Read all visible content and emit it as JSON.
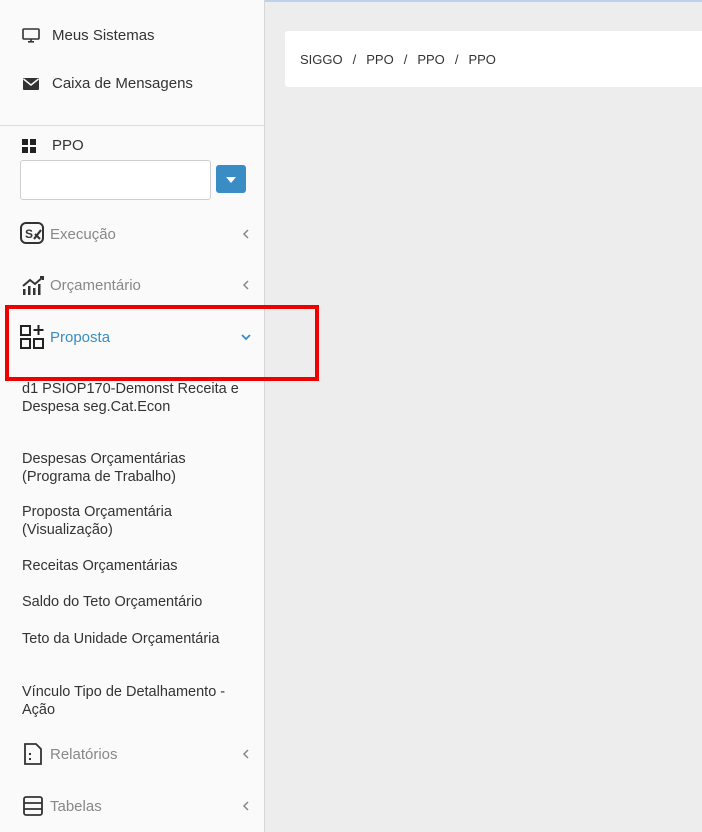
{
  "sidebar": {
    "top_links": [
      {
        "label": "Meus Sistemas",
        "icon": "monitor-icon"
      },
      {
        "label": "Caixa de Mensagens",
        "icon": "envelope-icon"
      }
    ],
    "module": {
      "label": "PPO",
      "icon": "grid-icon",
      "input_value": "",
      "dropdown_icon": "caret-down-icon"
    },
    "menu": [
      {
        "label": "Execução",
        "icon": "execution-icon",
        "expanded": false
      },
      {
        "label": "Orçamentário",
        "icon": "chart-icon",
        "expanded": false
      },
      {
        "label": "Proposta",
        "icon": "add-grid-icon",
        "expanded": true
      },
      {
        "label": "Relatórios",
        "icon": "report-icon",
        "expanded": false
      },
      {
        "label": "Tabelas",
        "icon": "table-icon",
        "expanded": false
      }
    ],
    "proposta_items": [
      "d1 PSIOP170-Demonst Receita e Despesa seg.Cat.Econ",
      "Despesas Orçamentárias (Programa de Trabalho)",
      "Proposta Orçamentária (Visualização)",
      "Receitas Orçamentárias",
      "Saldo do Teto Orçamentário",
      "Teto da Unidade Orçamentária",
      "Vínculo Tipo de Detalhamento - Ação"
    ]
  },
  "breadcrumb": [
    "SIGGO",
    "PPO",
    "PPO",
    "PPO"
  ],
  "colors": {
    "accent": "#3a8cc4",
    "highlight": "#ee0000",
    "text": "#333333",
    "muted": "#888888"
  }
}
